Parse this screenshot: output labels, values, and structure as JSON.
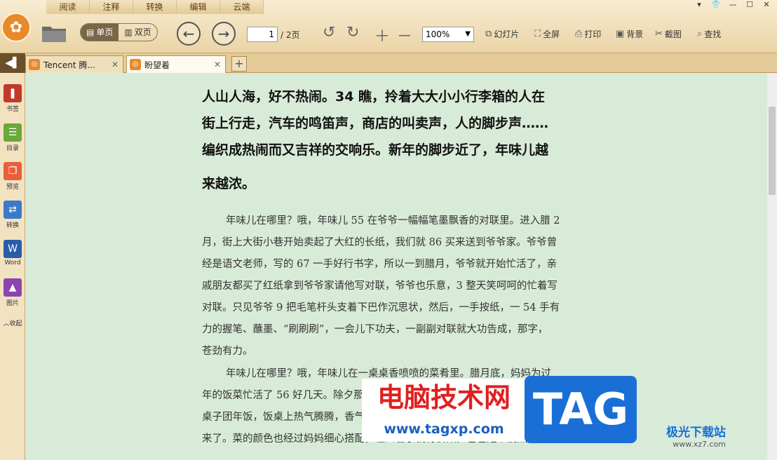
{
  "menu": [
    "阅读",
    "注释",
    "转换",
    "编辑",
    "云端"
  ],
  "window_controls": [
    "▾",
    "👕",
    "—",
    "☐",
    "✕"
  ],
  "toolbar": {
    "single_page": "单页",
    "double_page": "双页",
    "page_current": "1",
    "page_total": "/ 2页",
    "zoom": "100%",
    "slideshow": "幻灯片",
    "fullscreen": "全屏",
    "print": "打印",
    "background": "背景",
    "screenshot": "截图",
    "find": "查找"
  },
  "tabs": [
    {
      "label": "Tencent 腾..."
    },
    {
      "label": "盼望着"
    }
  ],
  "sidebar": [
    "书签",
    "目录",
    "预览",
    "转换",
    "Word",
    "图片",
    "收起"
  ],
  "doc": {
    "bold_lines": [
      "人山人海，好不热闹。34 瞧，拎着大大小小行李箱的人在",
      "街上行走，汽车的鸣笛声，商店的叫卖声，人的脚步声……",
      "编织成热闹而又吉祥的交响乐。新年的脚步近了，年味儿越",
      "来越浓。"
    ],
    "p1": [
      "年味儿在哪里？哦，年味儿 55 在爷爷一幅幅笔墨飘香的对联里。进入腊 2",
      "月，街上大街小巷开始卖起了大红的长纸，我们就 86 买来送到爷爷家。爷爷曾",
      "经是语文老师，写的 67 一手好行书字，所以一到腊月，爷爷就开始忙活了，亲",
      "戚朋友都买了红纸拿到爷爷家请他写对联，爷爷也乐意，3 整天笑呵呵的忙着写",
      "对联。只见爷爷 9 把毛笔杆头支着下巴作沉思状，然后，一手按纸，一 54 手有",
      "力的握笔、蘸墨、“刷刷刷”，一会儿下功夫，一副副对联就大功告成，那字，",
      "苍劲有力。"
    ],
    "p2": [
      "年味儿在哪里？哦，年味儿在一桌桌香喷喷的菜肴里。腊月底，妈妈为过",
      "年的饭菜忙活了 56 好几天。除夕那天，……………………………………",
      "桌子团年饭，饭桌上热气腾腾，香气扑鼻 08 而来，我深吸一口气，口水",
      "来了。菜的颜色也经过妈妈细心搭配，让人看了就有食欲。爸爸是个爱热闹的人，"
    ]
  },
  "watermark": {
    "cn": "电脑技术网",
    "url": "www.tagxp.com",
    "tag": "TAG",
    "site": "极光下载站",
    "site_url": "www.xz7.com"
  }
}
